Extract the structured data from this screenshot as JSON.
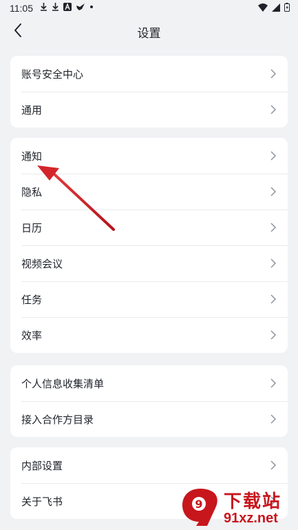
{
  "status_bar": {
    "time": "11:05",
    "left_icons": [
      "download-icon",
      "download-icon",
      "a-app-icon",
      "bird-app-icon",
      "dot-icon"
    ],
    "right_icons": [
      "wifi-icon",
      "signal-icon",
      "battery-icon"
    ]
  },
  "header": {
    "title": "设置",
    "back_icon": "chevron-left-icon"
  },
  "groups": [
    {
      "items": [
        {
          "label": "账号安全中心"
        },
        {
          "label": "通用"
        }
      ]
    },
    {
      "items": [
        {
          "label": "通知"
        },
        {
          "label": "隐私"
        },
        {
          "label": "日历"
        },
        {
          "label": "视频会议"
        },
        {
          "label": "任务"
        },
        {
          "label": "效率"
        }
      ]
    },
    {
      "items": [
        {
          "label": "个人信息收集清单"
        },
        {
          "label": "接入合作方目录"
        }
      ]
    },
    {
      "items": [
        {
          "label": "内部设置"
        },
        {
          "label": "关于飞书"
        }
      ]
    }
  ],
  "annotation": {
    "type": "red-arrow",
    "color": "#d3262b"
  },
  "watermark": {
    "logo_text": "91",
    "top_text": "下载站",
    "bottom_text": "91xz.net",
    "color": "#c8161d"
  },
  "colors": {
    "background": "#f1f2f4",
    "card": "#ffffff",
    "text": "#1f2329",
    "chevron": "#8f959e"
  }
}
